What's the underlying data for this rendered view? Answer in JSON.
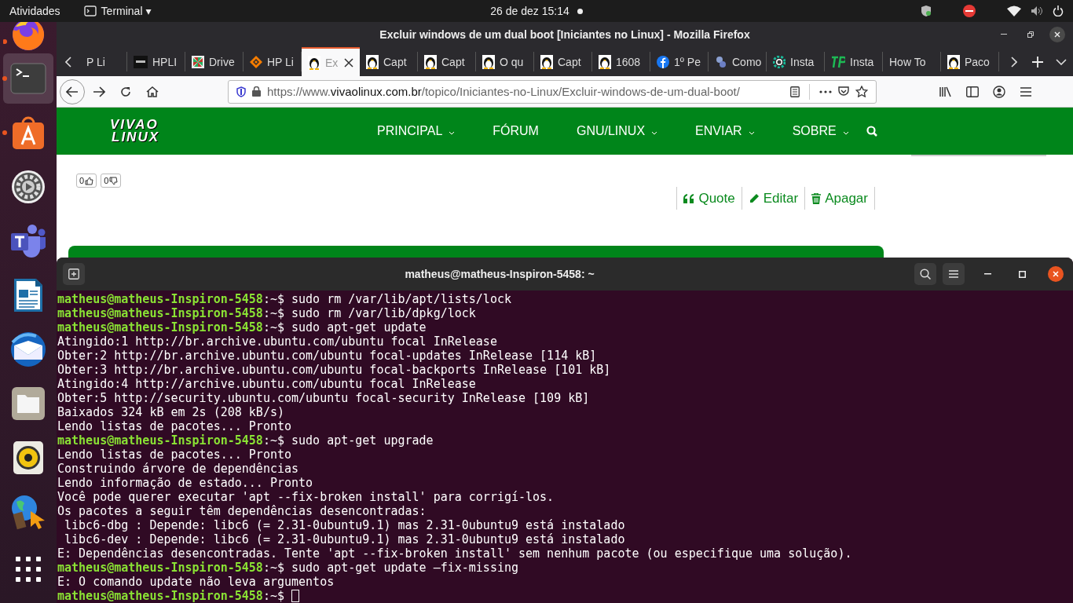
{
  "top_bar": {
    "activities": "Atividades",
    "app_menu": "Terminal ▾",
    "clock": "26 de dez  15:14",
    "notification_dot": true
  },
  "dock": [
    {
      "kind": "firefox",
      "running": true,
      "selected": false
    },
    {
      "kind": "terminal",
      "running": true,
      "selected": true
    },
    {
      "kind": "software",
      "running": true,
      "selected": false
    },
    {
      "kind": "settings",
      "running": false,
      "selected": false
    },
    {
      "kind": "teams",
      "running": false,
      "selected": false
    },
    {
      "kind": "document",
      "running": false,
      "selected": false
    },
    {
      "kind": "mail",
      "running": false,
      "selected": false
    },
    {
      "kind": "files",
      "running": false,
      "selected": false
    },
    {
      "kind": "speaker",
      "running": false,
      "selected": false
    },
    {
      "kind": "globe",
      "running": false,
      "selected": false
    },
    {
      "kind": "grid",
      "running": false,
      "selected": false
    }
  ],
  "browser": {
    "title": "Excluir windows de um dual boot [Iniciantes no Linux] - Mozilla Firefox",
    "tabs": [
      {
        "label": "P Li",
        "kind": "plain",
        "selected": false
      },
      {
        "label": "HPLI",
        "kind": "dark",
        "selected": false
      },
      {
        "label": "Drive",
        "kind": "drive",
        "selected": false
      },
      {
        "label": "HP Li",
        "kind": "diamond",
        "selected": false
      },
      {
        "label": "Ex",
        "kind": "penguin",
        "selected": true
      },
      {
        "label": "Capt",
        "kind": "penguin",
        "selected": false
      },
      {
        "label": "Capt",
        "kind": "penguin",
        "selected": false
      },
      {
        "label": "O qu",
        "kind": "penguin",
        "selected": false
      },
      {
        "label": "Capt",
        "kind": "penguin",
        "selected": false
      },
      {
        "label": "1608",
        "kind": "penguin",
        "selected": false
      },
      {
        "label": "1º Pe",
        "kind": "facebook",
        "selected": false
      },
      {
        "label": "Como",
        "kind": "blob",
        "selected": false
      },
      {
        "label": "Insta",
        "kind": "gear",
        "selected": false
      },
      {
        "label": "Insta",
        "kind": "tp",
        "selected": false
      },
      {
        "label": "How To",
        "kind": "plain",
        "selected": false
      },
      {
        "label": "Paco",
        "kind": "penguin",
        "selected": false
      }
    ],
    "url": {
      "scheme": "https://www.",
      "host": "vivaolinux.com.br",
      "path": "/topico/Iniciantes-no-Linux/Excluir-windows-de-um-dual-boot/"
    },
    "page": {
      "logo_top": "VIVAO",
      "logo_bottom": "LINUX",
      "nav": [
        {
          "label": "PRINCIPAL",
          "dropdown": true
        },
        {
          "label": "FÓRUM",
          "dropdown": false
        },
        {
          "label": "GNU/LINUX",
          "dropdown": true
        },
        {
          "label": "ENVIAR",
          "dropdown": true
        },
        {
          "label": "SOBRE",
          "dropdown": true
        }
      ],
      "votes": [
        {
          "count": "0",
          "kind": "up"
        },
        {
          "count": "0",
          "kind": "down"
        }
      ],
      "actions": [
        {
          "label": "Quote",
          "kind": "quote"
        },
        {
          "label": "Editar",
          "kind": "edit"
        },
        {
          "label": "Apagar",
          "kind": "delete"
        }
      ]
    }
  },
  "terminal": {
    "title": "matheus@matheus-Inspiron-5458: ~",
    "lines": [
      {
        "kind": "prompt",
        "prompt": "matheus@matheus-Inspiron-5458",
        "text": ":~$ sudo rm /var/lib/apt/lists/lock"
      },
      {
        "kind": "prompt",
        "prompt": "matheus@matheus-Inspiron-5458",
        "text": ":~$ sudo rm /var/lib/dpkg/lock"
      },
      {
        "kind": "prompt",
        "prompt": "matheus@matheus-Inspiron-5458",
        "text": ":~$ sudo apt-get update"
      },
      {
        "kind": "output",
        "text": "Atingido:1 http://br.archive.ubuntu.com/ubuntu focal InRelease"
      },
      {
        "kind": "output",
        "text": "Obter:2 http://br.archive.ubuntu.com/ubuntu focal-updates InRelease [114 kB]"
      },
      {
        "kind": "output",
        "text": "Obter:3 http://br.archive.ubuntu.com/ubuntu focal-backports InRelease [101 kB]"
      },
      {
        "kind": "output",
        "text": "Atingido:4 http://archive.ubuntu.com/ubuntu focal InRelease"
      },
      {
        "kind": "output",
        "text": "Obter:5 http://security.ubuntu.com/ubuntu focal-security InRelease [109 kB]"
      },
      {
        "kind": "output",
        "text": "Baixados 324 kB em 2s (208 kB/s)"
      },
      {
        "kind": "output",
        "text": "Lendo listas de pacotes... Pronto"
      },
      {
        "kind": "prompt",
        "prompt": "matheus@matheus-Inspiron-5458",
        "text": ":~$ sudo apt-get upgrade"
      },
      {
        "kind": "output",
        "text": "Lendo listas de pacotes... Pronto"
      },
      {
        "kind": "output",
        "text": "Construindo árvore de dependências"
      },
      {
        "kind": "output",
        "text": "Lendo informação de estado... Pronto"
      },
      {
        "kind": "output",
        "text": "Você pode querer executar 'apt --fix-broken install' para corrigí-los."
      },
      {
        "kind": "output",
        "text": "Os pacotes a seguir têm dependências desencontradas:"
      },
      {
        "kind": "output",
        "text": " libc6-dbg : Depende: libc6 (= 2.31-0ubuntu9.1) mas 2.31-0ubuntu9 está instalado"
      },
      {
        "kind": "output",
        "text": " libc6-dev : Depende: libc6 (= 2.31-0ubuntu9.1) mas 2.31-0ubuntu9 está instalado"
      },
      {
        "kind": "output",
        "text": "E: Dependências desencontradas. Tente 'apt --fix-broken install' sem nenhum pacote (ou especifique uma solução)."
      },
      {
        "kind": "prompt",
        "prompt": "matheus@matheus-Inspiron-5458",
        "text": ":~$ sudo apt-get update –fix-missing"
      },
      {
        "kind": "output",
        "text": "E: O comando update não leva argumentos"
      },
      {
        "kind": "prompt",
        "prompt": "matheus@matheus-Inspiron-5458",
        "text": ":~$ ",
        "cursor": true
      }
    ]
  }
}
